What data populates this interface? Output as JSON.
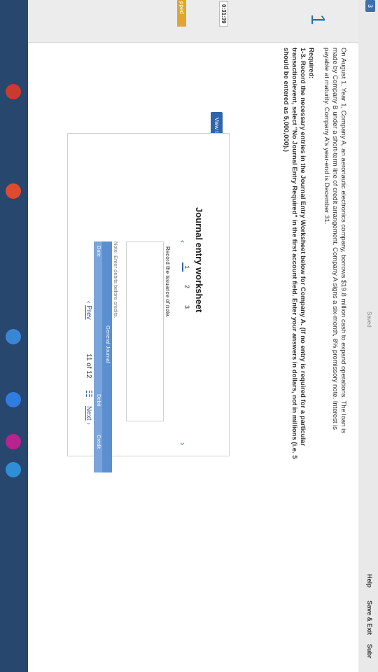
{
  "topbar": {
    "left_tab": "3",
    "saved": "Saved",
    "help": "Help",
    "save_exit": "Save & Exit",
    "submit": "Subr"
  },
  "gutter": {
    "question_number": "1",
    "timer": "0:31:39",
    "skipped": "pped"
  },
  "problem": {
    "line1": "On August 1, Year 1, Company A, an aeronautic electronics company, borrows $19.8 million cash to expand operations. The loan is",
    "line2": "made by Company B under a short-term line of credit arrangement. Company A signs a six-month, 8% promissory note. Interest is",
    "line3": "payable at maturity. Company A's year-end is December 31.",
    "required_head": "Required:",
    "req1_a": "1-3. Record the necessary entries in the Journal Entry Worksheet below for Company A. (If no entry is required for a particular",
    "req1_b": "transaction/event, select \"No Journal Entry Required\" in the first account field. Enter your answers in dollars, not in millions (i.e. 5",
    "req1_c": "should be entered as 5,000,000).)"
  },
  "worksheet": {
    "view_button": "View transaction list",
    "title": "Journal entry worksheet",
    "tabs": [
      "1",
      "2",
      "3"
    ],
    "record_text": "Record the issuance of note.",
    "note": "Note: Enter debits before credits.",
    "headers": {
      "general_journal": "General Journal",
      "date": "Date",
      "debit": "Debit",
      "credit": "Credit"
    }
  },
  "pager": {
    "prev": "Prev",
    "position": "11 of 12",
    "next": "Next"
  }
}
